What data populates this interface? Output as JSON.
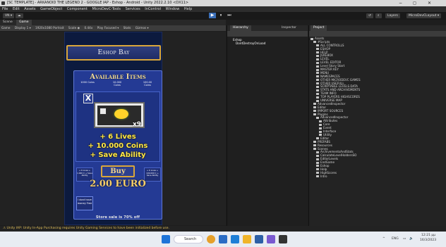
{
  "window": {
    "title": "[SC TEMPLATE] - ARKANOID THE LEGEND 2 - GOOGLE IAP - Eshop - Android - Unity 2022.2.10 <DX11>",
    "controls": [
      "−",
      "◻",
      "✕"
    ]
  },
  "menu": [
    "File",
    "Edit",
    "Assets",
    "GameObject",
    "Component",
    "MicroDevC-Tools",
    "Services",
    "InControl",
    "Window",
    "Help"
  ],
  "toolbar": {
    "account": "VN ▾",
    "cloud": "☁",
    "play": "▶",
    "pause": "⏸",
    "step": "⏭",
    "history": "↺",
    "search": "⌕",
    "layers": "Layers",
    "layout": "MicroDevCLayout ▾"
  },
  "game_panel": {
    "tabs": [
      "Scene",
      "Game"
    ],
    "sub": [
      "Game",
      "Display 1 ▾",
      "1920x1080 Portrait",
      "Scale ◉",
      "0.44x",
      "Play Focused ▾",
      "Stats",
      "Gizmos ▾"
    ]
  },
  "game": {
    "title": "Eshop Bay",
    "available": "Available Items",
    "coins": [
      {
        "amount": "1000 Coins",
        "label": ""
      },
      {
        "amount": "10.000",
        "label": "Coins"
      },
      {
        "amount": "100.00",
        "label": "Coins"
      }
    ],
    "close": "X",
    "quantity": "x9",
    "perks": [
      "+ 6 Lives",
      "+ 10.000 Coins",
      "+ Save Ability"
    ],
    "buy": "Buy",
    "price": "2.00 EURO",
    "side_left": "+ 6 Lives\n+ 1.000 C\n+ Save Ability",
    "side_right": "+ 6 Lives\n+ 100.000 C\n+ Save Ability",
    "no_money": "I dont have money Free",
    "sale": "Store sale is 70% off"
  },
  "hierarchy": {
    "tab": "Hierarchy",
    "items": [
      "Eshop",
      "DontDestroyOnLoad"
    ]
  },
  "inspector": {
    "tab": "Inspector"
  },
  "project": {
    "tab": "Project",
    "tree": [
      {
        "label": "Assets",
        "depth": 0
      },
      {
        "label": "#Scripts",
        "depth": 1
      },
      {
        "label": "ALL CONTROLLS",
        "depth": 2
      },
      {
        "label": "ESHOP",
        "depth": 2
      },
      {
        "label": "HELP",
        "depth": 2
      },
      {
        "label": "JUKEBOX",
        "depth": 2
      },
      {
        "label": "LEVEL",
        "depth": 2
      },
      {
        "label": "LEVEL EDITOR",
        "depth": 2
      },
      {
        "label": "Level Story Start",
        "depth": 2
      },
      {
        "label": "MASTER KEY",
        "depth": 2
      },
      {
        "label": "MENU",
        "depth": 2
      },
      {
        "label": "NAMESPACES",
        "depth": 2
      },
      {
        "label": "OTHER MICRODEVC GAMES",
        "depth": 2
      },
      {
        "label": "OTHER USEFULL",
        "depth": 2
      },
      {
        "label": "SCRIPTABLE LEVELS DATA",
        "depth": 2
      },
      {
        "label": "STATS AND ARCHIVEMENTS",
        "depth": 2
      },
      {
        "label": "TEAM INFO",
        "depth": 2
      },
      {
        "label": "TOP PLAYERS HIGHSCORES",
        "depth": 2
      },
      {
        "label": "UNIVERSE MAP",
        "depth": 2
      },
      {
        "label": "AdvancedInspector",
        "depth": 1
      },
      {
        "label": "Editor",
        "depth": 1
      },
      {
        "label": "IMPORT SOURCES",
        "depth": 1
      },
      {
        "label": "Plugins",
        "depth": 1
      },
      {
        "label": "AdvancedInspector",
        "depth": 2
      },
      {
        "label": "Attributes",
        "depth": 3
      },
      {
        "label": "Core",
        "depth": 3
      },
      {
        "label": "Event",
        "depth": 3
      },
      {
        "label": "Interface",
        "depth": 3
      },
      {
        "label": "Utility",
        "depth": 3
      },
      {
        "label": "Editor",
        "depth": 2
      },
      {
        "label": "PREFABS",
        "depth": 1
      },
      {
        "label": "Resources",
        "depth": 1
      },
      {
        "label": "Scenes",
        "depth": 1
      },
      {
        "label": "ArchivementsAndStats",
        "depth": 2
      },
      {
        "label": "CalculateLevelHoldersSO",
        "depth": 2
      },
      {
        "label": "EditorLevels",
        "depth": 2
      },
      {
        "label": "EndGame",
        "depth": 2
      },
      {
        "label": "Eshop",
        "depth": 2
      },
      {
        "label": "Help",
        "depth": 2
      },
      {
        "label": "HighScores",
        "depth": 2
      },
      {
        "label": "Intro",
        "depth": 2
      }
    ]
  },
  "status": "Unity IAP: Unity In-App Purchasing requires Unity Gaming Services to have been initialized before use.",
  "taskbar": {
    "search": "Search",
    "lang": "ENG",
    "time": "12:21 μμ",
    "date": "16/3/2023",
    "chevron": "^",
    "speaker": "🔈",
    "network": "▭"
  },
  "colors": {
    "accent": "#d9a63a",
    "perk_yellow": "#ffe94a",
    "panel_blue": "#243a94",
    "editor_bg": "#1e1e1e",
    "status_warning": "#e2c05a"
  }
}
